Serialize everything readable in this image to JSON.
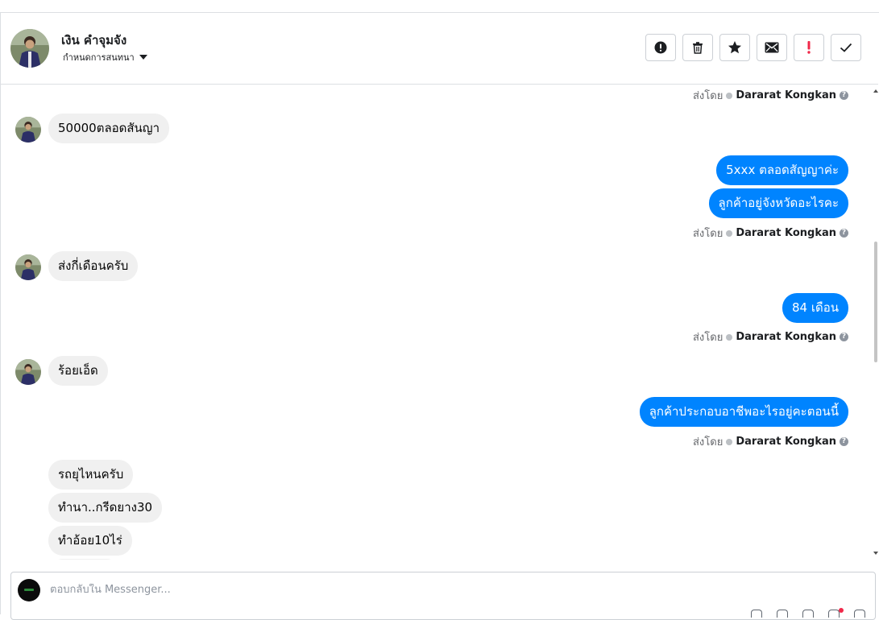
{
  "header": {
    "contact_name": "เงิน คําจุมจัง",
    "subtitle": "กําหนดการสนทนา",
    "toolbar": [
      {
        "name": "report-spam-button",
        "icon": "alert-circle-icon"
      },
      {
        "name": "delete-button",
        "icon": "trash-icon"
      },
      {
        "name": "star-button",
        "icon": "star-icon"
      },
      {
        "name": "mark-unread-button",
        "icon": "envelope-icon"
      },
      {
        "name": "mark-important-button",
        "icon": "exclamation-icon"
      },
      {
        "name": "mark-done-button",
        "icon": "checkmark-icon"
      }
    ]
  },
  "sent_by": {
    "prefix": "ส่งโดย",
    "agent": "Dararat Kongkan",
    "help": "?"
  },
  "messages": [
    {
      "id": "m1",
      "side": "in",
      "text": "50000ตลอดสันญา"
    },
    {
      "id": "m2",
      "side": "out",
      "text": "5xxx ตลอดสัญญาค่ะ"
    },
    {
      "id": "m3",
      "side": "out",
      "text": "ลูกค้าอยู่จังหวัดอะไรคะ"
    },
    {
      "id": "m4",
      "side": "in",
      "text": "ส่งกี่เดือนครับ"
    },
    {
      "id": "m5",
      "side": "out",
      "text": "84 เดือน"
    },
    {
      "id": "m6",
      "side": "in",
      "text": "ร้อยเอ็ด"
    },
    {
      "id": "m7",
      "side": "out",
      "text": "ลูกค้าประกอบอาชีพอะไรอยู่คะตอนนี้"
    },
    {
      "id": "m8",
      "side": "in",
      "text": "รถยุไหนครับ"
    },
    {
      "id": "m9",
      "side": "in",
      "text": "ทำนา..กรีดยาง30"
    },
    {
      "id": "m10",
      "side": "in",
      "text": "ทำอ้อย10ไร่"
    }
  ],
  "composer": {
    "placeholder": "ตอบกลับใน Messenger..."
  },
  "colors": {
    "outgoing_bubble": "#0084ff",
    "incoming_bubble": "#f0f0f0",
    "important_red": "#f02849"
  }
}
